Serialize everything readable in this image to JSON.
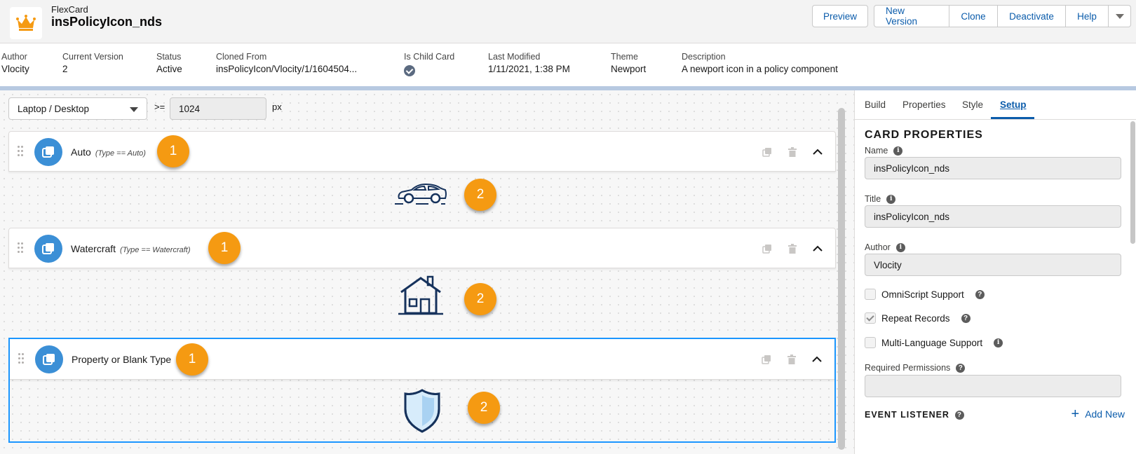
{
  "header": {
    "kind": "FlexCard",
    "name": "insPolicyIcon_nds",
    "buttons": {
      "preview": "Preview",
      "new_version": "New Version",
      "clone": "Clone",
      "deactivate": "Deactivate",
      "help": "Help"
    }
  },
  "details": {
    "author": {
      "label": "Author",
      "value": "Vlocity"
    },
    "current_version": {
      "label": "Current Version",
      "value": "2"
    },
    "status": {
      "label": "Status",
      "value": "Active"
    },
    "cloned_from": {
      "label": "Cloned From",
      "value": "insPolicyIcon/Vlocity/1/1604504..."
    },
    "is_child_card": {
      "label": "Is Child Card"
    },
    "last_modified": {
      "label": "Last Modified",
      "value": "1/11/2021, 1:38 PM"
    },
    "theme": {
      "label": "Theme",
      "value": "Newport"
    },
    "description": {
      "label": "Description",
      "value": "A newport icon in a policy component"
    }
  },
  "canvas": {
    "device": "Laptop / Desktop",
    "operator": ">=",
    "width_value": "1024",
    "unit": "px",
    "states": [
      {
        "name": "Auto",
        "condition": "(Type == Auto)",
        "icon": "car-icon",
        "badge1": "1",
        "badge2": "2"
      },
      {
        "name": "Watercraft",
        "condition": "(Type == Watercraft)",
        "icon": "house-icon",
        "badge1": "1",
        "badge2": "2"
      },
      {
        "name": "Property or Blank Type",
        "condition": "",
        "icon": "shield-icon",
        "badge1": "1",
        "badge2": "2"
      }
    ]
  },
  "panel": {
    "tabs": [
      "Build",
      "Properties",
      "Style",
      "Setup"
    ],
    "active_tab": "Setup",
    "section_title": "CARD PROPERTIES",
    "name_label": "Name",
    "name_value": "insPolicyIcon_nds",
    "title_label": "Title",
    "title_value": "insPolicyIcon_nds",
    "author_label": "Author",
    "author_value": "Vlocity",
    "omniscript_label": "OmniScript Support",
    "omniscript_checked": false,
    "repeat_label": "Repeat Records",
    "repeat_checked": true,
    "multilang_label": "Multi-Language Support",
    "multilang_checked": false,
    "permissions_label": "Required Permissions",
    "permissions_value": "",
    "event_listener_label": "EVENT LISTENER",
    "add_new_label": "Add New"
  },
  "colors": {
    "brand_blue": "#0b5cab",
    "badge_orange": "#f59a12",
    "state_icon_blue": "#3b8fd6",
    "selected_border": "#1b96ff"
  }
}
